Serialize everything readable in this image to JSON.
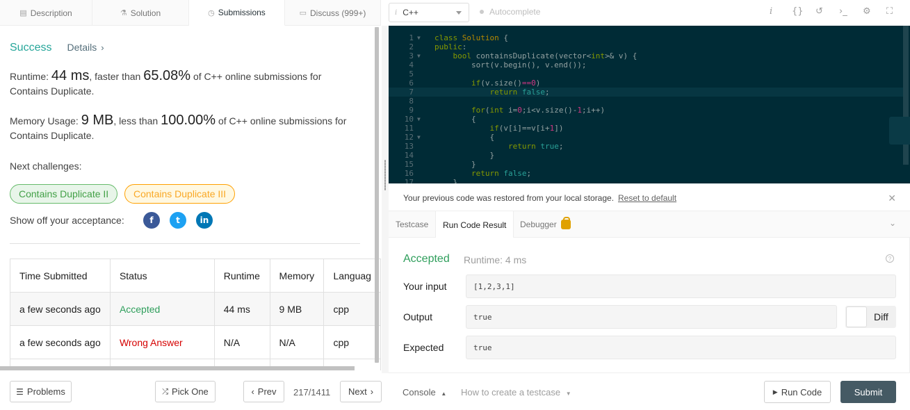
{
  "left_tabs": [
    {
      "icon": "description-icon",
      "glyph": "▤",
      "label": "Description"
    },
    {
      "icon": "solution-icon",
      "glyph": "⚗",
      "label": "Solution"
    },
    {
      "icon": "clock-icon",
      "glyph": "◷",
      "label": "Submissions"
    },
    {
      "icon": "discuss-icon",
      "glyph": "▭",
      "label": "Discuss (999+)"
    }
  ],
  "submission": {
    "status": "Success",
    "details_label": "Details",
    "runtime_prefix": "Runtime: ",
    "runtime_value": "44 ms",
    "runtime_mid": ", faster than ",
    "runtime_pct": "65.08%",
    "runtime_suffix": " of C++ online submissions for Contains Duplicate.",
    "memory_prefix": "Memory Usage: ",
    "memory_value": "9 MB",
    "memory_mid": ", less than ",
    "memory_pct": "100.00%",
    "memory_suffix": " of C++ online submissions for Contains Duplicate.",
    "next_challenges_label": "Next challenges:",
    "challenges": [
      "Contains Duplicate II",
      "Contains Duplicate III"
    ],
    "show_off_label": "Show off your acceptance:",
    "social": [
      {
        "icon": "facebook-icon",
        "glyph": "f",
        "color": "#3b5998"
      },
      {
        "icon": "twitter-icon",
        "glyph": "t",
        "color": "#1da1f2"
      },
      {
        "icon": "linkedin-icon",
        "glyph": "in",
        "color": "#0077b5"
      }
    ]
  },
  "table": {
    "headers": [
      "Time Submitted",
      "Status",
      "Runtime",
      "Memory",
      "Languag"
    ],
    "rows": [
      [
        "a few seconds ago",
        "Accepted",
        "44 ms",
        "9 MB",
        "cpp"
      ],
      [
        "a few seconds ago",
        "Wrong Answer",
        "N/A",
        "N/A",
        "cpp"
      ]
    ]
  },
  "bottom_left": {
    "problems": "Problems",
    "pick_one": "Pick One",
    "prev": "Prev",
    "page": "217/1411",
    "next": "Next"
  },
  "toolbar": {
    "language": "C++",
    "autocomplete": "Autocomplete",
    "icons": [
      "info-icon",
      "braces-icon",
      "reset-icon",
      "terminal-icon",
      "settings-icon",
      "fullscreen-icon"
    ]
  },
  "editor": {
    "lines": [
      "1",
      "2",
      "3",
      "4",
      "5",
      "6",
      "7",
      "8",
      "9",
      "10",
      "11",
      "12",
      "13",
      "14",
      "15",
      "16",
      "17"
    ]
  },
  "notice": {
    "text": "Your previous code was restored from your local storage.",
    "reset": "Reset to default"
  },
  "result_tabs": {
    "testcase": "Testcase",
    "run_code_result": "Run Code Result",
    "debugger": "Debugger"
  },
  "result": {
    "status": "Accepted",
    "runtime": "Runtime: 4 ms",
    "input_label": "Your input",
    "input_value": "[1,2,3,1]",
    "output_label": "Output",
    "output_value": "true",
    "expected_label": "Expected",
    "expected_value": "true",
    "diff_label": "Diff"
  },
  "bottom_right": {
    "console": "Console",
    "howto": "How to create a testcase",
    "run_code": "Run Code",
    "submit": "Submit"
  },
  "colors": {
    "success": "#26a69a",
    "accepted": "#2e9e5b",
    "wrong": "#d50000",
    "editor_bg": "#002b36",
    "submit_bg": "#455a64"
  }
}
